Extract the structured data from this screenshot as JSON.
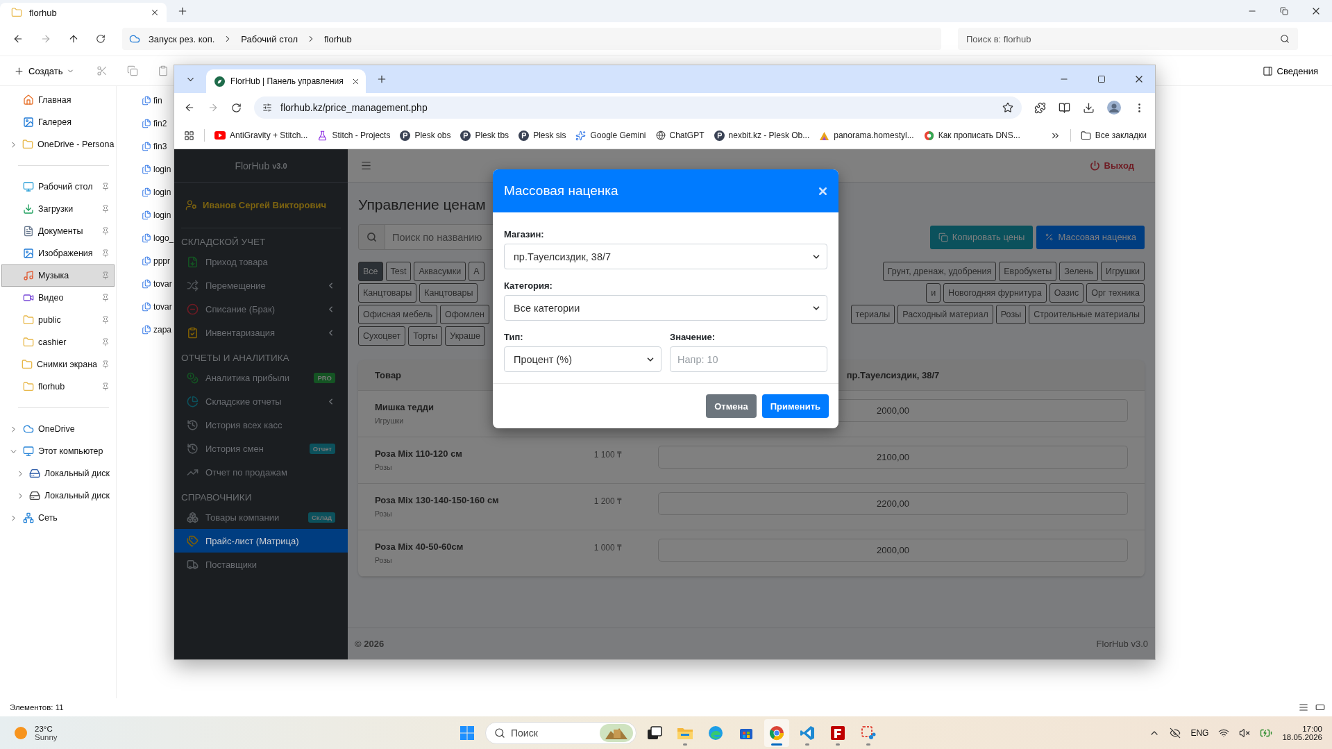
{
  "explorer": {
    "tab_title": "florhub",
    "breadcrumb": [
      "Запуск рез. коп.",
      "Рабочий стол",
      "florhub"
    ],
    "search_placeholder": "Поиск в: florhub",
    "create_label": "Создать",
    "details_label": "Сведения",
    "nav": [
      [
        {
          "label": "Главная",
          "kind": "home",
          "selected": false
        },
        {
          "label": "Галерея",
          "kind": "gallery",
          "selected": false
        },
        {
          "label": "OneDrive - Persona",
          "kind": "folder",
          "selected": false,
          "expanded": false
        }
      ],
      [
        {
          "label": "Рабочий стол",
          "kind": "desktop",
          "selected": false,
          "pinned": true
        },
        {
          "label": "Загрузки",
          "kind": "download",
          "selected": false,
          "pinned": true
        },
        {
          "label": "Документы",
          "kind": "docs",
          "selected": false,
          "pinned": true
        },
        {
          "label": "Изображения",
          "kind": "images",
          "selected": false,
          "pinned": true
        },
        {
          "label": "Музыка",
          "kind": "music",
          "selected": true,
          "pinned": true
        },
        {
          "label": "Видео",
          "kind": "video",
          "selected": false,
          "pinned": true
        },
        {
          "label": "public",
          "kind": "folder",
          "selected": false,
          "pinned": true
        },
        {
          "label": "cashier",
          "kind": "folder",
          "selected": false,
          "pinned": true
        },
        {
          "label": "Снимки экрана",
          "kind": "folder",
          "selected": false,
          "pinned": true
        },
        {
          "label": "florhub",
          "kind": "folder",
          "selected": false,
          "pinned": true
        }
      ],
      [
        {
          "label": "OneDrive",
          "kind": "cloud",
          "selected": false,
          "expanded": false
        },
        {
          "label": "Этот компьютер",
          "kind": "pc",
          "selected": false,
          "expanded": true,
          "children": [
            {
              "label": "Локальный диск",
              "kind": "windrive",
              "selected": false,
              "expanded": false
            },
            {
              "label": "Локальный диск",
              "kind": "drive",
              "selected": false,
              "expanded": false
            }
          ]
        },
        {
          "label": "Сеть",
          "kind": "network",
          "selected": false,
          "expanded": false
        }
      ]
    ],
    "files": [
      "fin",
      "fin2",
      "fin3",
      "login",
      "login",
      "login",
      "logo_",
      "pppr",
      "tovar",
      "tovar",
      "zapa"
    ],
    "status": "Элементов: 11"
  },
  "browser": {
    "tab_title": "FlorHub | Панель управления",
    "url": "florhub.kz/price_management.php",
    "bookmarks": [
      {
        "label": "AntiGravity + Stitch...",
        "kind": "youtube"
      },
      {
        "label": "Stitch - Projects",
        "kind": "flask"
      },
      {
        "label": "Plesk obs",
        "kind": "plesk"
      },
      {
        "label": "Plesk tbs",
        "kind": "plesk"
      },
      {
        "label": "Plesk sis",
        "kind": "plesk"
      },
      {
        "label": "Google Gemini",
        "kind": "gemini"
      },
      {
        "label": "ChatGPT",
        "kind": "openai"
      },
      {
        "label": "nexbit.kz - Plesk Ob...",
        "kind": "plesk"
      },
      {
        "label": "panorama.homestyl...",
        "kind": "panorama"
      },
      {
        "label": "Как прописать DNS...",
        "kind": "google"
      }
    ],
    "all_bookmarks": "Все закладки"
  },
  "app": {
    "brand": "FlorHub",
    "version": "v3.0",
    "user": "Иванов Сергей Викторович",
    "sections": [
      {
        "title": "СКЛАДСКОЙ УЧЕТ",
        "items": [
          {
            "label": "Приход товара",
            "kind": "file-in",
            "color": "#145423",
            "submenu": false,
            "selected": false
          },
          {
            "label": "Перемещение",
            "kind": "shuffle",
            "color": "#4d5155",
            "submenu": true,
            "selected": false
          },
          {
            "label": "Списание (Брак)",
            "kind": "minus",
            "color": "#6e1b23",
            "submenu": true,
            "selected": false
          },
          {
            "label": "Инвентаризация",
            "kind": "clipboard",
            "color": "#806004",
            "submenu": true,
            "selected": false
          }
        ]
      },
      {
        "title": "ОТЧЕТЫ И АНАЛИТИКА",
        "items": [
          {
            "label": "Аналитика прибыли",
            "kind": "coins",
            "color": "#145423",
            "submenu": false,
            "selected": false,
            "badge": {
              "text": "PRO",
              "color": "#145423"
            }
          },
          {
            "label": "Складские отчеты",
            "kind": "pie",
            "color": "#0c515c",
            "submenu": true,
            "selected": false
          },
          {
            "label": "История всех касс",
            "kind": "history",
            "color": "#575b5f",
            "submenu": false,
            "selected": false
          },
          {
            "label": "История смен",
            "kind": "history",
            "color": "#575b5f",
            "submenu": false,
            "selected": false,
            "badge": {
              "text": "Отчет",
              "color": "#0c515c"
            }
          },
          {
            "label": "Отчет по продажам",
            "kind": "chart",
            "color": "#575b5f",
            "submenu": false,
            "selected": false
          }
        ]
      },
      {
        "title": "СПРАВОЧНИКИ",
        "items": [
          {
            "label": "Товары компании",
            "kind": "boxes",
            "color": "#575b5f",
            "submenu": false,
            "selected": false,
            "badge": {
              "text": "Склад",
              "color": "#0c515c"
            }
          },
          {
            "label": "Прайс-лист (Матрица)",
            "kind": "tags",
            "color": "#806004",
            "submenu": false,
            "selected": true
          },
          {
            "label": "Поставщики",
            "kind": "truck",
            "color": "#575b5f",
            "submenu": false,
            "selected": false
          }
        ]
      }
    ],
    "logout": "Выход",
    "title": "Управление ценам",
    "search_placeholder": "Поиск по названию",
    "copy_button": "Копировать цены",
    "markup_button": "Массовая наценка",
    "category_rows": [
      {
        "left": [
          {
            "label": "Все",
            "selected": true
          },
          {
            "label": "Test",
            "selected": false
          },
          {
            "label": "Аквасумки",
            "selected": false
          },
          {
            "label": "А",
            "selected": false
          }
        ],
        "right": [
          {
            "label": "Грунт, дренаж, удобрения",
            "selected": false
          },
          {
            "label": "Евробукеты",
            "selected": false
          },
          {
            "label": "Зелень",
            "selected": false
          },
          {
            "label": "Игрушки",
            "selected": false
          }
        ]
      },
      {
        "left": [
          {
            "label": "Канцтовары",
            "selected": false
          },
          {
            "label": "Канцтовары",
            "selected": false
          }
        ],
        "right": [
          {
            "label": "и",
            "selected": false
          },
          {
            "label": "Новогодняя фурнитура",
            "selected": false
          },
          {
            "label": "Оазис",
            "selected": false
          },
          {
            "label": "Орг техника",
            "selected": false
          }
        ]
      },
      {
        "left": [
          {
            "label": "Офисная мебель",
            "selected": false
          },
          {
            "label": "Офомлен",
            "selected": false
          }
        ],
        "right": [
          {
            "label": "териалы",
            "selected": false
          },
          {
            "label": "Расходный материал",
            "selected": false
          },
          {
            "label": "Розы",
            "selected": false
          },
          {
            "label": "Строительные материалы",
            "selected": false
          }
        ]
      },
      {
        "left": [
          {
            "label": "Сухоцвет",
            "selected": false
          },
          {
            "label": "Торты",
            "selected": false
          },
          {
            "label": "Украше",
            "selected": false
          }
        ],
        "right": []
      }
    ],
    "table": {
      "columns": [
        "Товар",
        "пр.Тауелсиздик, 38/7"
      ],
      "rows": [
        {
          "name": "Мишка тедди",
          "category": "Игрушки",
          "value": "2000,00"
        },
        {
          "name": "Роза Mix 110-120 см",
          "category": "Розы",
          "price": "1 100 ₸",
          "value": "2100,00"
        },
        {
          "name": "Роза Mix 130-140-150-160 см",
          "category": "Розы",
          "price": "1 200 ₸",
          "value": "2200,00"
        },
        {
          "name": "Роза Mix 40-50-60см",
          "category": "Розы",
          "price": "1 000 ₸",
          "value": "2000,00"
        }
      ]
    },
    "footer_left": "© 2026",
    "footer_right": "FlorHub v3.0",
    "modal": {
      "title": "Массовая наценка",
      "shop_label": "Магазин:",
      "shop_value": "пр.Тауелсиздик, 38/7",
      "category_label": "Категория:",
      "category_value": "Все категории",
      "type_label": "Тип:",
      "type_value": "Процент (%)",
      "value_label": "Значение:",
      "value_placeholder": "Напр: 10",
      "cancel": "Отмена",
      "apply": "Применить"
    }
  },
  "taskbar": {
    "temperature": "23°C",
    "condition": "Sunny",
    "search_placeholder": "Поиск",
    "apps": [
      {
        "kind": "taskview",
        "running": false,
        "selected": false
      },
      {
        "kind": "explorer",
        "running": true,
        "selected": false
      },
      {
        "kind": "edge",
        "running": false,
        "selected": false
      },
      {
        "kind": "store",
        "running": false,
        "selected": false
      },
      {
        "kind": "chrome",
        "running": true,
        "selected": true
      },
      {
        "kind": "vscode",
        "running": true,
        "selected": false
      },
      {
        "kind": "filezilla",
        "running": true,
        "selected": false
      },
      {
        "kind": "snip",
        "running": true,
        "selected": false
      }
    ],
    "language": "ENG",
    "time": "17:00",
    "date": "18.05.2026"
  }
}
